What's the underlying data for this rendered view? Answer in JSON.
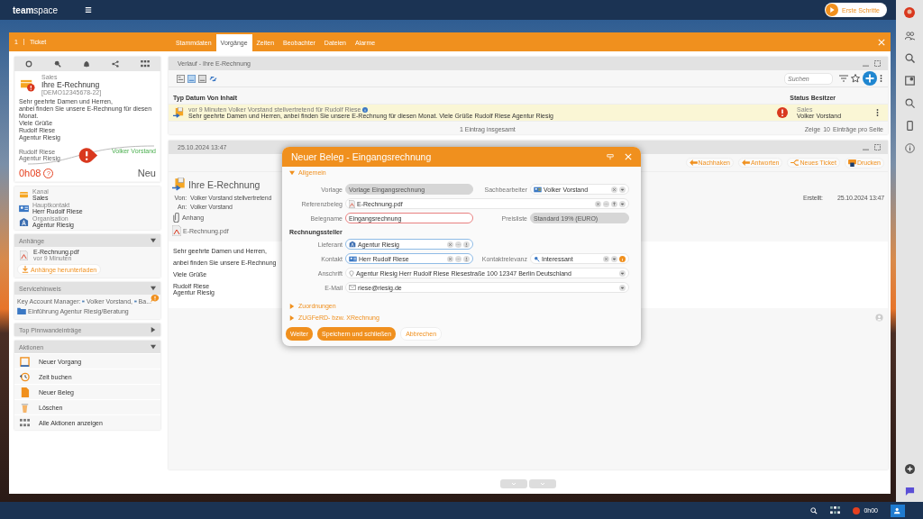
{
  "app": {
    "logo_bold": "team",
    "logo_light": "space",
    "start_button": "Erste Schritte"
  },
  "ticket": {
    "number": "1",
    "title": "Ticket",
    "tabs": [
      {
        "label": "Stammdaten",
        "selected": false
      },
      {
        "label": "Vorgänge",
        "selected": true
      },
      {
        "label": "Zeiten",
        "selected": false
      },
      {
        "label": "Beobachter",
        "selected": false
      },
      {
        "label": "Dateien",
        "selected": false
      },
      {
        "label": "Alarme",
        "selected": false
      }
    ]
  },
  "card": {
    "category": "Sales",
    "title": "Ihre E-Rechnung",
    "id": "[DEMO12345678-22]",
    "body": [
      "Sehr geehrte Damen und Herren,",
      "anbei finden Sie unsere E-Rechnung für diesen Monat.",
      "Viele Grüße",
      "Rudolf Riese",
      "Agentur Riesig"
    ],
    "from": [
      "Rudolf Riese",
      "Agentur Riesig"
    ],
    "owner": "Volker Vorstand",
    "time": "0h08",
    "help": "?",
    "status": "Neu"
  },
  "info": [
    {
      "label": "Kanal",
      "value": "Sales",
      "kind": "channel"
    },
    {
      "label": "Hauptkontakt",
      "value": "Herr Rudolf Riese",
      "kind": "contact"
    },
    {
      "label": "Organisation",
      "value": "Agentur Riesig",
      "kind": "org"
    }
  ],
  "attachments": {
    "title": "Anhänge",
    "expanded": true,
    "file": "E-Rechnung.pdf",
    "age": "vor 9 Minuten",
    "button": "Anhänge herunterladen"
  },
  "service": {
    "title": "Servicehinweis",
    "expanded": true,
    "manager_label": "Key Account Manager:",
    "managers": [
      "Volker Vorstand,",
      "Ba..."
    ],
    "link": "Einführung Agentur Riesig/Beratung"
  },
  "pinboard": {
    "title": "Top Pinnwandeinträge",
    "expanded": false
  },
  "actions": {
    "title": "Aktionen",
    "expanded": true,
    "items": [
      {
        "label": "Neuer Vorgang",
        "kind": "process"
      },
      {
        "label": "Zeit buchen",
        "kind": "time"
      },
      {
        "label": "Neuer Beleg",
        "kind": "document"
      },
      {
        "label": "Löschen",
        "kind": "delete"
      },
      {
        "label": "Alle Aktionen anzeigen",
        "kind": "all"
      }
    ]
  },
  "history": {
    "title": "Verlauf - Ihre E-Rechnung",
    "search_placeholder": "Suchen",
    "columns": [
      "Typ",
      "Datum",
      "Von",
      "Inhalt",
      "Status",
      "Besitzer"
    ],
    "rows": [
      {
        "meta": "vor 9 Minuten Volker Vorstand stellvertretend für Rudolf Riese",
        "text": "Sehr geehrte Damen und Herren, anbei finden Sie unsere E-Rechnung für diesen Monat. Viele Grüße Rudolf Riese Agentur Riesig",
        "owner_group": "Sales",
        "owner": "Volker Vorstand"
      }
    ],
    "total": "1 Eintrag insgesamt",
    "page_prefix": "Zeige",
    "page_size": "10",
    "page_suffix": "Einträge pro Seite"
  },
  "message": {
    "date": "25.10.2024 13:47",
    "buttons": [
      {
        "label": "Nachhaken",
        "kind": "followup"
      },
      {
        "label": "Antworten",
        "kind": "reply"
      },
      {
        "label": "Neues Ticket",
        "kind": "ticket"
      },
      {
        "label": "Drucken",
        "kind": "print"
      }
    ],
    "title": "Ihre E-Rechnung",
    "from_label": "Von:",
    "from": "Volker Vorstand stellvertretend",
    "to_label": "An:",
    "to": "Volker Vorstand",
    "created_label": "Erstellt:",
    "created": "25.10.2024 13:47",
    "attachment_label": "Anhang",
    "attachment": "E-Rechnung.pdf",
    "body": [
      "Sehr geehrte Damen und Herren,",
      "anbei finden Sie unsere E-Rechnung",
      "Viele Grüße",
      "Rudolf Riese",
      "Agentur Riesig"
    ]
  },
  "dialog": {
    "title": "Neuer Beleg - Eingangsrechnung",
    "section": {
      "label": "Allgemein",
      "expanded": true
    },
    "fields": [
      {
        "label": "Vorlage",
        "value": "Vorlage Eingangsrechnung",
        "kind": "readonly"
      },
      {
        "label": "Sachbearbeiter",
        "value": "Volker Vorstand",
        "kind": "user"
      },
      {
        "label": "Referenzbeleg",
        "value": "E-Rechnung.pdf",
        "kind": "file"
      },
      {
        "label": "Belegname",
        "value": "Eingangsrechnung",
        "kind": "required"
      },
      {
        "label": "Preisliste",
        "value": "Standard 19% (EURO)",
        "kind": "readonly"
      }
    ],
    "subheading": "Rechnungssteller",
    "fields2": [
      {
        "label": "Lieferant",
        "value": "Agentur Riesig",
        "kind": "org"
      },
      {
        "label": "Kontakt",
        "value": "Herr Rudolf Riese",
        "kind": "contact"
      },
      {
        "label": "Kontaktrelevanz",
        "value": "Interessant",
        "kind": "rating"
      },
      {
        "label": "Anschrift",
        "value": "Agentur Riesig Herr Rudolf Riese Riesestraße 100 12347 Berlin Deutschland",
        "kind": "address"
      },
      {
        "label": "E-Mail",
        "value": "riese@riesig.de",
        "kind": "email"
      }
    ],
    "sections": [
      {
        "label": "Zuordnungen",
        "expanded": false
      },
      {
        "label": "ZUGFeRD- bzw. XRechnung",
        "expanded": false
      }
    ],
    "buttons": [
      {
        "label": "Weiter",
        "kind": "primary"
      },
      {
        "label": "Speichern und schließen",
        "kind": "primary"
      },
      {
        "label": "Abbrechen",
        "kind": "secondary"
      }
    ]
  },
  "status_bar": {
    "timer": "0h00"
  }
}
